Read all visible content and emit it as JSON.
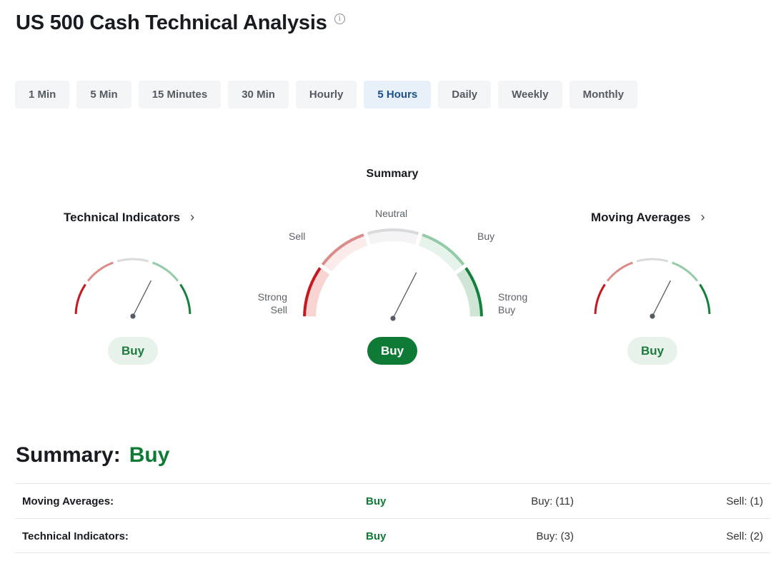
{
  "page": {
    "title": "US 500 Cash Technical Analysis",
    "info_icon": "info-icon"
  },
  "tabs": [
    {
      "label": "1 Min",
      "active": false
    },
    {
      "label": "5 Min",
      "active": false
    },
    {
      "label": "15 Minutes",
      "active": false
    },
    {
      "label": "30 Min",
      "active": false
    },
    {
      "label": "Hourly",
      "active": false
    },
    {
      "label": "5 Hours",
      "active": true
    },
    {
      "label": "Daily",
      "active": false
    },
    {
      "label": "Weekly",
      "active": false
    },
    {
      "label": "Monthly",
      "active": false
    }
  ],
  "gauges": {
    "left": {
      "title": "Technical Indicators",
      "signal": "Buy",
      "needle_value": 0.65
    },
    "center": {
      "title": "Summary",
      "signal": "Buy",
      "needle_value": 0.65,
      "labels": {
        "strong_sell_1": "Strong",
        "strong_sell_2": "Sell",
        "sell": "Sell",
        "neutral": "Neutral",
        "buy": "Buy",
        "strong_buy_1": "Strong",
        "strong_buy_2": "Buy"
      }
    },
    "right": {
      "title": "Moving Averages",
      "signal": "Buy",
      "needle_value": 0.65
    }
  },
  "colors": {
    "strong_sell": "#c8181f",
    "sell": "#dc8c88",
    "neutral": "#d9dadc",
    "buy": "#94cba7",
    "strong_buy": "#13803b",
    "buy_text": "#0f7a36"
  },
  "summary": {
    "label": "Summary:",
    "verdict": "Buy",
    "rows": [
      {
        "name": "Moving Averages:",
        "signal": "Buy",
        "buy": "Buy: (11)",
        "sell": "Sell: (1)"
      },
      {
        "name": "Technical Indicators:",
        "signal": "Buy",
        "buy": "Buy: (3)",
        "sell": "Sell: (2)"
      }
    ]
  }
}
